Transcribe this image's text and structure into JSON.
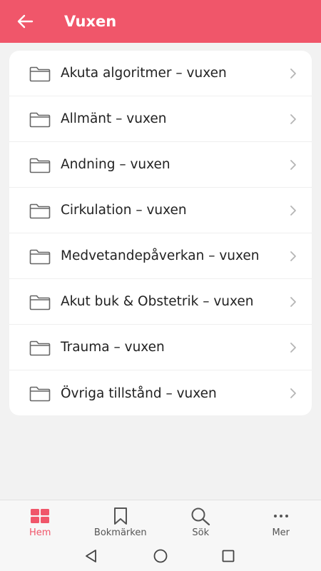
{
  "header": {
    "title": "Vuxen",
    "background_color": "#f0566a",
    "back_icon": "arrow-left-icon"
  },
  "list": {
    "items": [
      {
        "label": "Akuta algoritmer – vuxen",
        "icon": "folder-icon"
      },
      {
        "label": "Allmänt – vuxen",
        "icon": "folder-icon"
      },
      {
        "label": "Andning – vuxen",
        "icon": "folder-icon"
      },
      {
        "label": "Cirkulation – vuxen",
        "icon": "folder-icon"
      },
      {
        "label": "Medvetandepåverkan – vuxen",
        "icon": "folder-icon"
      },
      {
        "label": "Akut buk & Obstetrik – vuxen",
        "icon": "folder-icon"
      },
      {
        "label": "Trauma – vuxen",
        "icon": "folder-icon"
      },
      {
        "label": "Övriga tillstånd – vuxen",
        "icon": "folder-icon"
      }
    ]
  },
  "bottom_nav": {
    "accent_color": "#f0566a",
    "items": [
      {
        "label": "Hem",
        "icon": "grid-icon",
        "active": true
      },
      {
        "label": "Bokmärken",
        "icon": "bookmark-icon",
        "active": false
      },
      {
        "label": "Sök",
        "icon": "search-icon",
        "active": false
      },
      {
        "label": "Mer",
        "icon": "more-icon",
        "active": false
      }
    ]
  },
  "system_nav": {
    "buttons": [
      "back-triangle-icon",
      "home-circle-icon",
      "recents-square-icon"
    ]
  }
}
